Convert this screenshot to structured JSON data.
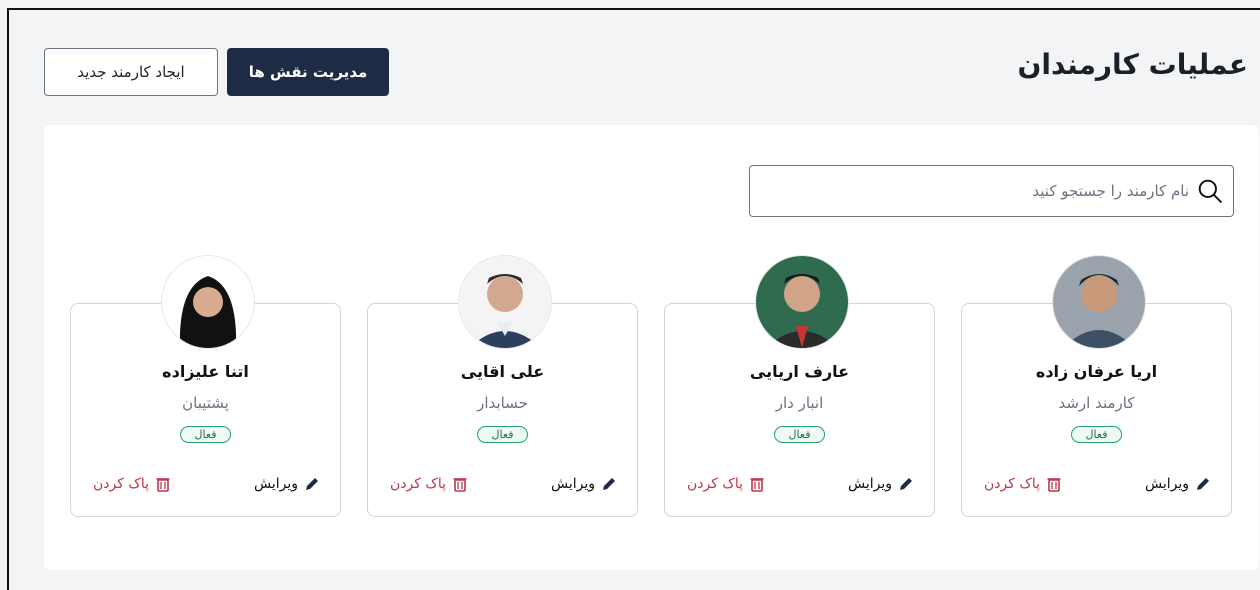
{
  "page": {
    "title": "عملیات کارمندان"
  },
  "toolbar": {
    "manage_roles_label": "مدیریت نقش ها",
    "new_employee_label": "ایجاد کارمند جدید"
  },
  "search": {
    "placeholder": "نام کارمند را جستجو کنید",
    "value": ""
  },
  "colors": {
    "primary": "#1f2a44",
    "status_active": "#22a06b",
    "delete": "#c0354a"
  },
  "employees": [
    {
      "name": "اریا عرفان زاده",
      "role": "کارمند ارشد",
      "status": "فعال",
      "edit_label": "ویرایش",
      "delete_label": "پاک کردن"
    },
    {
      "name": "عارف اریایی",
      "role": "انبار دار",
      "status": "فعال",
      "edit_label": "ویرایش",
      "delete_label": "پاک کردن"
    },
    {
      "name": "علی اقایی",
      "role": "حسابدار",
      "status": "فعال",
      "edit_label": "ویرایش",
      "delete_label": "پاک کردن"
    },
    {
      "name": "اتنا علیزاده",
      "role": "پشتیبان",
      "status": "فعال",
      "edit_label": "ویرایش",
      "delete_label": "پاک کردن"
    }
  ]
}
